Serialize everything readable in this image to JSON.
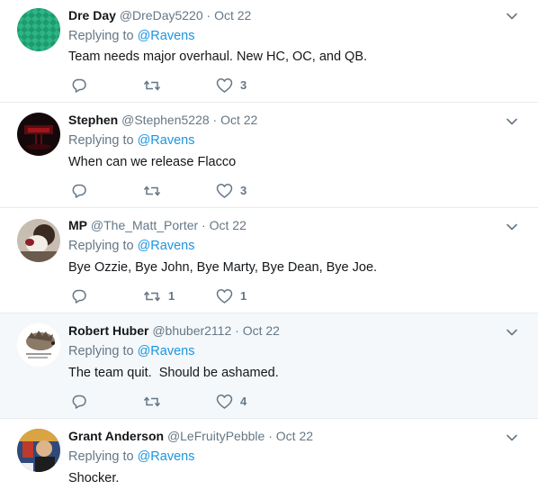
{
  "tweets": [
    {
      "name": "Dre Day",
      "handle": "@DreDay5220",
      "separator": "·",
      "time": "Oct 22",
      "replying_label": "Replying to",
      "replying_to": "@Ravens",
      "text": "Team needs major overhaul. New HC, OC, and QB.",
      "retweets": "",
      "likes": "3"
    },
    {
      "name": "Stephen",
      "handle": "@Stephen5228",
      "separator": "·",
      "time": "Oct 22",
      "replying_label": "Replying to",
      "replying_to": "@Ravens",
      "text": "When can we release Flacco",
      "retweets": "",
      "likes": "3"
    },
    {
      "name": "MP",
      "handle": "@The_Matt_Porter",
      "separator": "·",
      "time": "Oct 22",
      "replying_label": "Replying to",
      "replying_to": "@Ravens",
      "text": "Bye Ozzie, Bye John, Bye Marty, Bye Dean, Bye Joe.",
      "retweets": "1",
      "likes": "1"
    },
    {
      "name": "Robert Huber",
      "handle": "@bhuber2112",
      "separator": "·",
      "time": "Oct 22",
      "replying_label": "Replying to",
      "replying_to": "@Ravens",
      "text": "The team quit.  Should be ashamed.",
      "retweets": "",
      "likes": "4"
    },
    {
      "name": "Grant Anderson",
      "handle": "@LeFruityPebble",
      "separator": "·",
      "time": "Oct 22",
      "replying_label": "Replying to",
      "replying_to": "@Ravens",
      "text": "Shocker.",
      "retweets": "",
      "likes": ""
    }
  ],
  "icons": {
    "reply": "reply-icon",
    "retweet": "retweet-icon",
    "like": "heart-icon",
    "caret": "chevron-down-icon"
  },
  "colors": {
    "name": "#14171a",
    "muted": "#657786",
    "link": "#1b95e0",
    "highlight_bg": "#f5f8fa",
    "divider": "#e6ecf0"
  }
}
